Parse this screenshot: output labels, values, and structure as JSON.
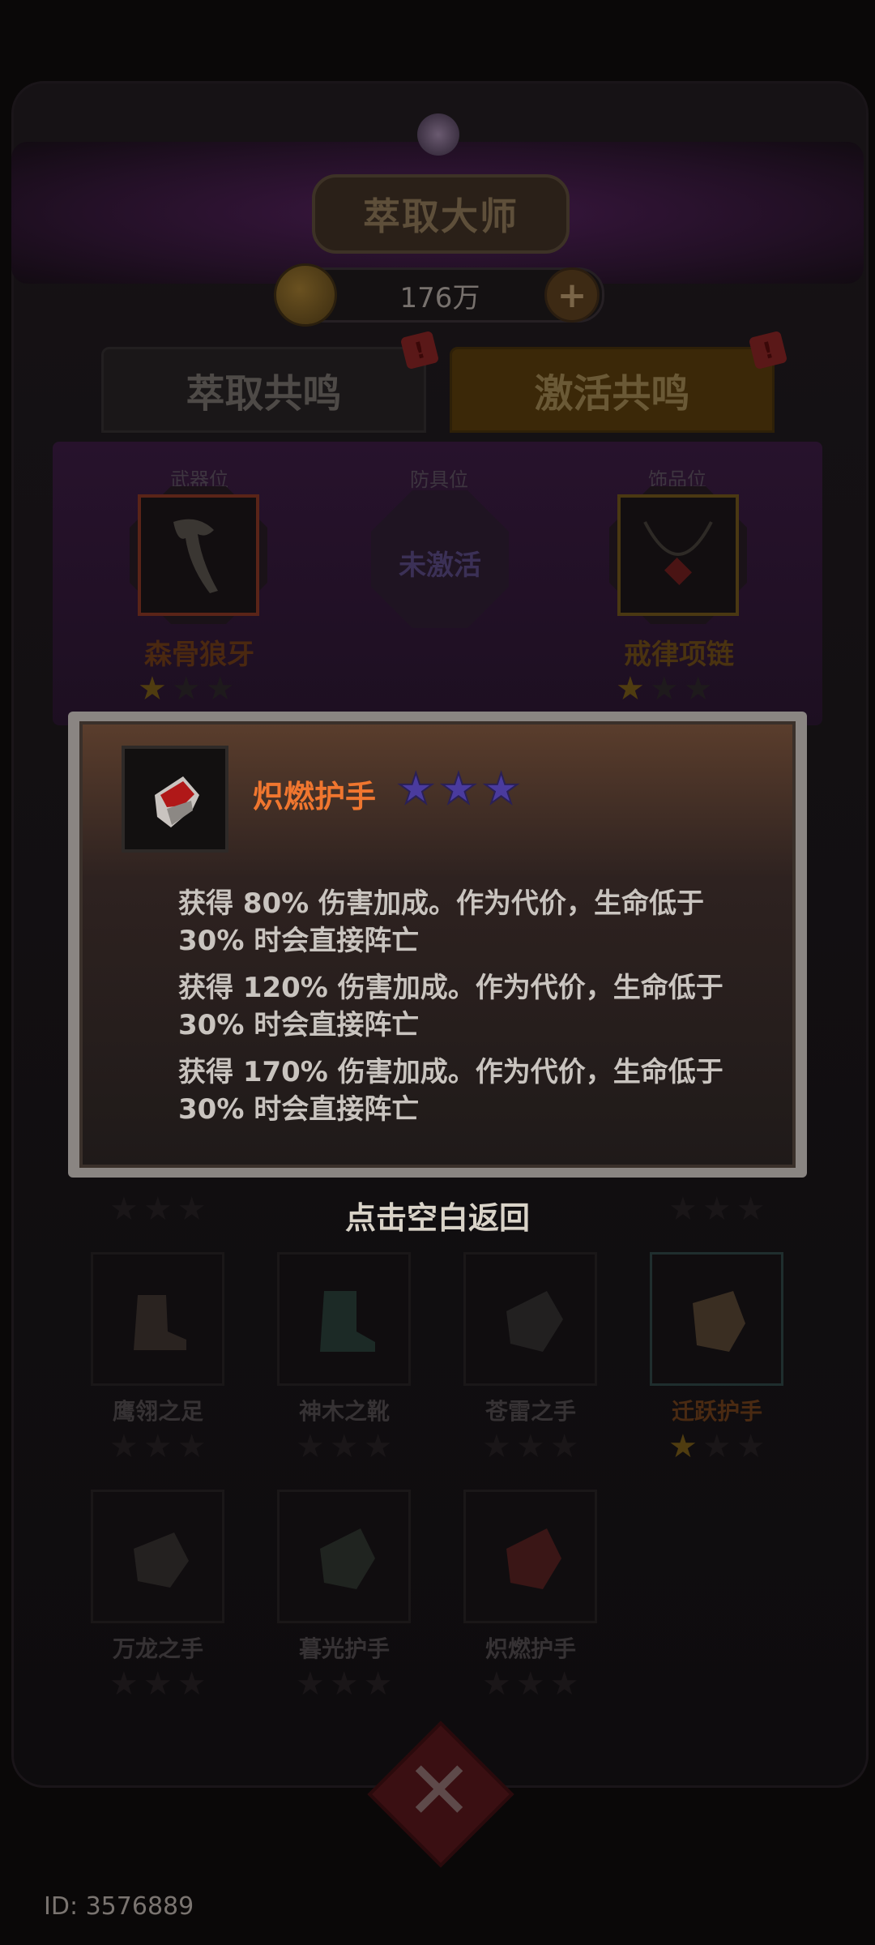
{
  "header": {
    "title": "萃取大师"
  },
  "currency": {
    "amount": "176万",
    "plus": "+"
  },
  "tabs": [
    {
      "label": "萃取共鸣",
      "badge": "!"
    },
    {
      "label": "激活共鸣",
      "badge": "!"
    }
  ],
  "slots": [
    {
      "label": "武器位",
      "name": "森骨狼牙",
      "stars": 1,
      "max_stars": 3
    },
    {
      "label": "防具位",
      "name": "未激活",
      "stars": 0,
      "max_stars": 3
    },
    {
      "label": "饰品位",
      "name": "戒律项链",
      "stars": 1,
      "max_stars": 3
    }
  ],
  "tooltip": {
    "item_name": "炽燃护手",
    "stars": 3,
    "descriptions": [
      {
        "line1": "获得 80% 伤害加成。作为代价，生命低于",
        "line2": "30% 时会直接阵亡"
      },
      {
        "line1": "获得 120% 伤害加成。作为代价，生命低于",
        "line2": "30% 时会直接阵亡"
      },
      {
        "line1": "获得 170% 伤害加成。作为代价，生命低于",
        "line2": "30% 时会直接阵亡"
      }
    ]
  },
  "dismiss_hint": "点击空白返回",
  "grid_items": [
    {
      "name": "鹰翎之足",
      "stars": 0
    },
    {
      "name": "神木之靴",
      "stars": 0
    },
    {
      "name": "苍雷之手",
      "stars": 0
    },
    {
      "name": "迁跃护手",
      "stars": 1
    },
    {
      "name": "万龙之手",
      "stars": 0
    },
    {
      "name": "暮光护手",
      "stars": 0
    },
    {
      "name": "炽燃护手",
      "stars": 0
    }
  ],
  "footer": {
    "id_text": "ID: 3576889",
    "close": "✕"
  },
  "colors": {
    "tooltip_title": "#f0762f",
    "star_filled": "#4a3b9e",
    "dismiss_text": "#d9d3c8"
  }
}
